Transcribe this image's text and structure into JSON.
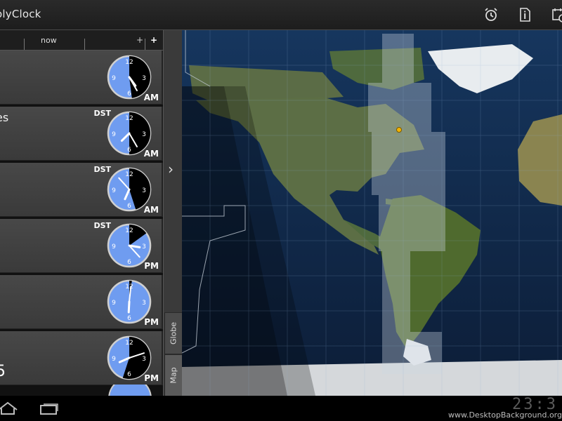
{
  "app": {
    "title": "olyClock"
  },
  "actionbar": {
    "icons": [
      "alarm-icon",
      "info-icon",
      "calendar-clock-icon"
    ]
  },
  "timeline": {
    "now_label": "now",
    "zoom_out": "+",
    "zoom_in": "+"
  },
  "cards": [
    {
      "city": "",
      "dst": "",
      "ampm": "AM",
      "sub": "",
      "big": "",
      "clock_hour": 4.8,
      "clock_min": 25,
      "night_fraction": 0.48
    },
    {
      "city": "es",
      "dst": "DST",
      "ampm": "AM",
      "sub": "",
      "big": "",
      "clock_hour": 7.5,
      "clock_min": 25,
      "night_fraction": 0.5
    },
    {
      "city": "",
      "dst": "DST",
      "ampm": "AM",
      "sub": ",",
      "big": "",
      "clock_hour": 6.8,
      "clock_min": 53,
      "night_fraction": 0.45
    },
    {
      "city": "",
      "dst": "DST",
      "ampm": "PM",
      "sub": ",",
      "big": "",
      "clock_hour": 3.3,
      "clock_min": 23,
      "night_fraction": 0.15
    },
    {
      "city": "",
      "dst": "",
      "ampm": "PM",
      "sub": ",",
      "big": "",
      "clock_hour": 6.1,
      "clock_min": 1,
      "night_fraction": 0.02
    },
    {
      "city": "",
      "dst": "",
      "ampm": "PM",
      "sub": "",
      "big": "5",
      "clock_hour": 8.2,
      "clock_min": 12,
      "night_fraction": 0.55
    }
  ],
  "rail": {
    "chevron": "›",
    "tabs": [
      "Globe",
      "Map"
    ]
  },
  "clock_face": {
    "n12": "12",
    "n3": "3",
    "n6": "6",
    "n9": "9"
  },
  "system": {
    "clock": "23:3",
    "watermark": "www.DesktopBackground.org"
  },
  "colors": {
    "clock_day": "#6f9cf0",
    "clock_night": "#000000",
    "marker": "#f5b400"
  }
}
